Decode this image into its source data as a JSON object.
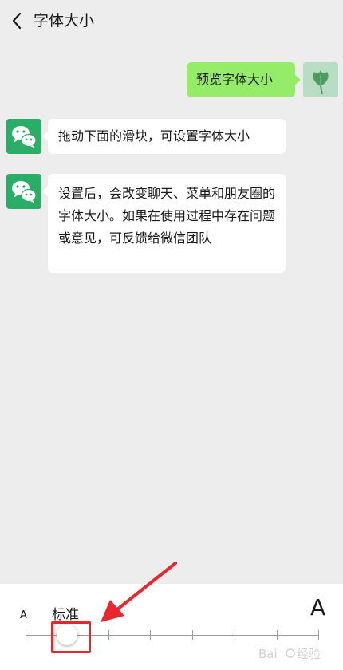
{
  "header": {
    "title": "字体大小",
    "back_icon": "chevron-left-icon"
  },
  "messages": [
    {
      "side": "right",
      "text": "预览字体大小",
      "avatar": "ginkgo-leaf-avatar"
    },
    {
      "side": "left",
      "text": "拖动下面的滑块，可设置字体大小",
      "avatar": "wechat-logo-avatar"
    },
    {
      "side": "left",
      "text": "设置后，会改变聊天、菜单和朋友圈的字体大小。如果在使用过程中存在问题或意见，可反馈给微信团队",
      "avatar": "wechat-logo-avatar"
    }
  ],
  "font_slider": {
    "min_label": "A",
    "max_label": "A",
    "current_label": "标准",
    "levels": 8,
    "selected_level": 2
  },
  "colors": {
    "background": "#ededed",
    "sent_bubble": "#95ec69",
    "wechat_green": "#2aae67",
    "annotation_red": "#e8262d"
  },
  "annotations": {
    "arrow": "red-arrow",
    "highlight": "red-rectangle"
  }
}
